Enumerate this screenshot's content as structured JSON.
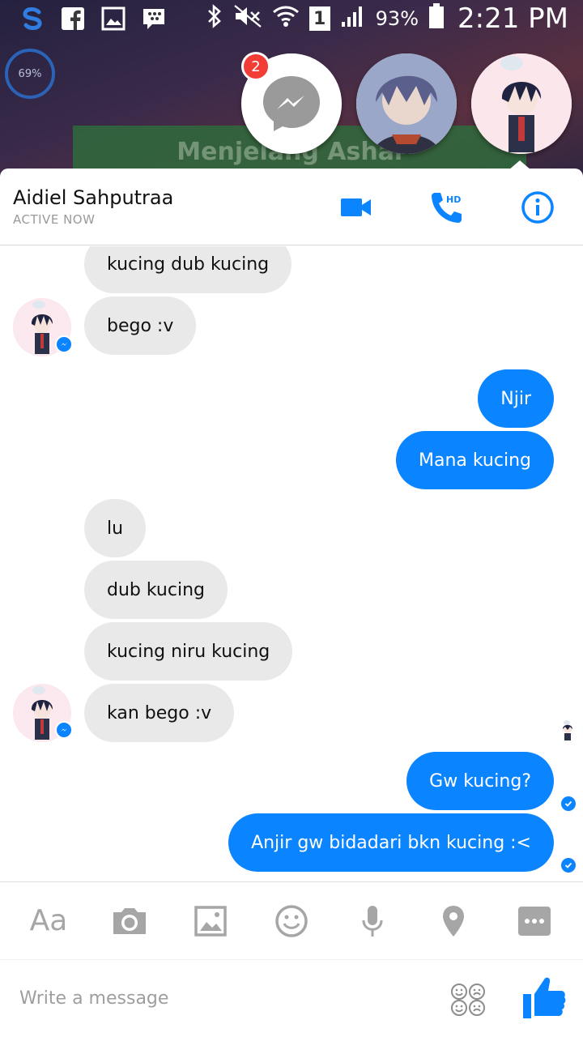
{
  "status_bar": {
    "battery": "93%",
    "time": "2:21 PM",
    "sim": "1"
  },
  "wallpaper": {
    "widget_text": "Menjelang Ashar",
    "widget_percent": "69%"
  },
  "chat_heads": {
    "badge_count": "2"
  },
  "header": {
    "contact_name": "Aidiel Sahputraa",
    "presence": "ACTIVE NOW",
    "hd_label": "HD"
  },
  "messages": [
    {
      "side": "in",
      "text": "kucing dub kucing"
    },
    {
      "side": "in",
      "text": "bego :v"
    },
    {
      "side": "out",
      "text": "Njir"
    },
    {
      "side": "out",
      "text": "Mana kucing"
    },
    {
      "side": "in",
      "text": "lu"
    },
    {
      "side": "in",
      "text": "dub kucing"
    },
    {
      "side": "in",
      "text": "kucing niru kucing"
    },
    {
      "side": "in",
      "text": "kan bego :v"
    },
    {
      "side": "out",
      "text": "Gw kucing?"
    },
    {
      "side": "out",
      "text": "Anjir gw bidadari bkn kucing :<"
    }
  ],
  "composer": {
    "text_tool_label": "Aa",
    "placeholder": "Write a message"
  },
  "colors": {
    "accent": "#0a84ff",
    "incoming_bubble": "#e9e9ea",
    "badge": "#f23c36"
  }
}
